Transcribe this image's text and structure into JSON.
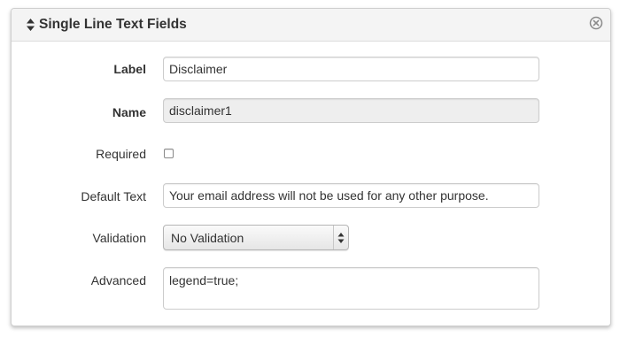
{
  "panel": {
    "title": "Single Line Text Fields",
    "header_icon": "sort-icon",
    "close_icon": "close-icon"
  },
  "fields": {
    "label": {
      "label": "Label",
      "value": "Disclaimer"
    },
    "name": {
      "label": "Name",
      "value": "disclaimer1"
    },
    "required": {
      "label": "Required",
      "checked": false
    },
    "default_text": {
      "label": "Default Text",
      "value": "Your email address will not be used for any other purpose."
    },
    "validation": {
      "label": "Validation",
      "selected": "No Validation"
    },
    "advanced": {
      "label": "Advanced",
      "value": "legend=true;"
    }
  },
  "colors": {
    "header_bg": "#f4f4f4",
    "readonly_bg": "#eeeeee",
    "border": "#cccccc",
    "text": "#333333"
  }
}
